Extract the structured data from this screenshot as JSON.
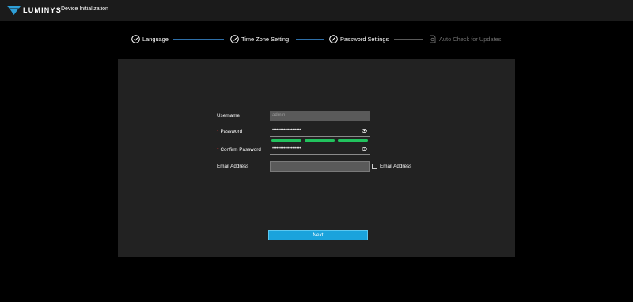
{
  "header": {
    "brand": "LUMINYS",
    "title": "Device Initialization",
    "brand_color": "#2e9fd8"
  },
  "steps": [
    {
      "label": "Language",
      "icon": "check-circle-icon",
      "state": "done"
    },
    {
      "label": "Time Zone Setting",
      "icon": "check-circle-icon",
      "state": "done"
    },
    {
      "label": "Password Settings",
      "icon": "edit-circle-icon",
      "state": "active"
    },
    {
      "label": "Auto Check for Updates",
      "icon": "update-document-icon",
      "state": "pending"
    }
  ],
  "form": {
    "username_label": "Username",
    "username_value": "admin",
    "password_label": "Password",
    "password_value": "••••••••••••••••••••",
    "confirm_label": "Confirm Password",
    "confirm_value": "••••••••••••••••••••",
    "email_label": "Email Address",
    "email_value": "",
    "email_checkbox_label": "Email Address",
    "email_checkbox_checked": false,
    "password_strength_level": 3,
    "password_strength_max": 3,
    "strength_color": "#22c35e",
    "required_marker": "*"
  },
  "actions": {
    "next_label": "Next",
    "accent_color": "#1aa3dc"
  }
}
